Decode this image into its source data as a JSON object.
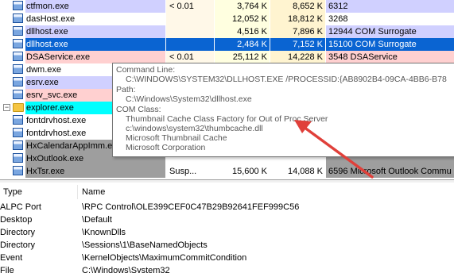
{
  "processes": [
    {
      "name": "ctfmon.exe",
      "cpu": "< 0.01",
      "private_bytes": "3,764 K",
      "working_set": "8,652 K",
      "pid": "6312",
      "description": "",
      "style": "svc"
    },
    {
      "name": "dasHost.exe",
      "cpu": "",
      "private_bytes": "12,052 K",
      "working_set": "18,812 K",
      "pid": "3268",
      "description": "",
      "style": "white"
    },
    {
      "name": "dllhost.exe",
      "cpu": "",
      "private_bytes": "4,516 K",
      "working_set": "7,896 K",
      "pid": "12944",
      "description": "COM Surrogate",
      "style": "svc"
    },
    {
      "name": "dllhost.exe",
      "cpu": "",
      "private_bytes": "2,484 K",
      "working_set": "7,152 K",
      "pid": "15100",
      "description": "COM Surrogate",
      "style": "selected"
    },
    {
      "name": "DSAService.exe",
      "cpu": "< 0.01",
      "private_bytes": "25,112 K",
      "working_set": "14,228 K",
      "pid": "3548",
      "description": "DSAService",
      "style": "svcpink"
    },
    {
      "name": "dwm.exe",
      "cpu": "",
      "private_bytes": "",
      "working_set": "",
      "pid": "",
      "description": "",
      "style": "white"
    },
    {
      "name": "esrv.exe",
      "cpu": "",
      "private_bytes": "",
      "working_set": "",
      "pid": "",
      "description": "",
      "style": "svc"
    },
    {
      "name": "esrv_svc.exe",
      "cpu": "",
      "private_bytes": "",
      "working_set": "",
      "pid": "",
      "description": "",
      "style": "svcpink"
    },
    {
      "name": "explorer.exe",
      "cpu": "",
      "private_bytes": "",
      "working_set": "",
      "pid": "",
      "description": "",
      "style": "self"
    },
    {
      "name": "fontdrvhost.exe",
      "cpu": "",
      "private_bytes": "",
      "working_set": "",
      "pid": "",
      "description": "",
      "style": "white"
    },
    {
      "name": "fontdrvhost.exe",
      "cpu": "",
      "private_bytes": "",
      "working_set": "",
      "pid": "",
      "description": "",
      "style": "white"
    },
    {
      "name": "HxCalendarAppImm.exe",
      "cpu": "",
      "private_bytes": "",
      "working_set": "",
      "pid": "",
      "description": "",
      "style": "dark"
    },
    {
      "name": "HxOutlook.exe",
      "cpu": "",
      "private_bytes": "",
      "working_set": "",
      "pid": "",
      "description": "",
      "style": "dark"
    },
    {
      "name": "HxTsr.exe",
      "cpu": "Susp...",
      "private_bytes": "15,600 K",
      "working_set": "14,088 K",
      "pid": "6596",
      "description": "Microsoft Outlook Commu",
      "style": "dark"
    }
  ],
  "tooltip": {
    "command_line_label": "Command Line:",
    "command_line": "C:\\WINDOWS\\SYSTEM32\\DLLHOST.EXE /PROCESSID:{AB8902B4-09CA-4BB6-B78",
    "path_label": "Path:",
    "path": "C:\\Windows\\System32\\dllhost.exe",
    "com_class_label": "COM Class:",
    "com_lines": [
      "Thumbnail Cache Class Factory for Out of Proc Server",
      "c:\\windows\\system32\\thumbcache.dll",
      "Microsoft Thumbnail Cache",
      "Microsoft Corporation"
    ]
  },
  "handles": {
    "headers": {
      "type": "Type",
      "name": "Name"
    },
    "rows": [
      {
        "type": "ALPC Port",
        "name": "\\RPC Control\\OLE399CEF0C47B29B92641FEF999C56"
      },
      {
        "type": "Desktop",
        "name": "\\Default"
      },
      {
        "type": "Directory",
        "name": "\\KnownDlls"
      },
      {
        "type": "Directory",
        "name": "\\Sessions\\1\\BaseNamedObjects"
      },
      {
        "type": "Event",
        "name": "\\KernelObjects\\MaximumCommitCondition"
      },
      {
        "type": "File",
        "name": "C:\\Windows\\System32"
      }
    ]
  },
  "colors": {
    "services_row": "#d0d0ff",
    "service_pink_row": "#ffd0d0",
    "selected_row": "#0a64d2",
    "own_process_row": "#00ffff",
    "suspended_row": "#9e9e9e",
    "arrow": "#e0403a"
  },
  "icons": {
    "process": "service-window-icon",
    "explorer": "folder-icon",
    "tree": "tree-collapse-icon"
  }
}
